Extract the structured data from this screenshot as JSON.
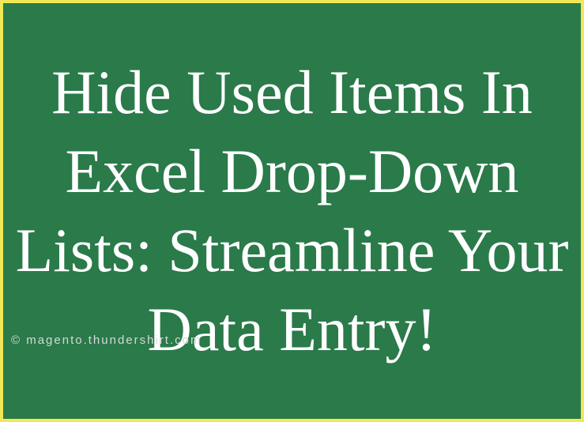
{
  "title": "Hide Used Items In Excel Drop-Down Lists: Streamline Your Data Entry!",
  "watermark": "© magento.thundershirt.com"
}
